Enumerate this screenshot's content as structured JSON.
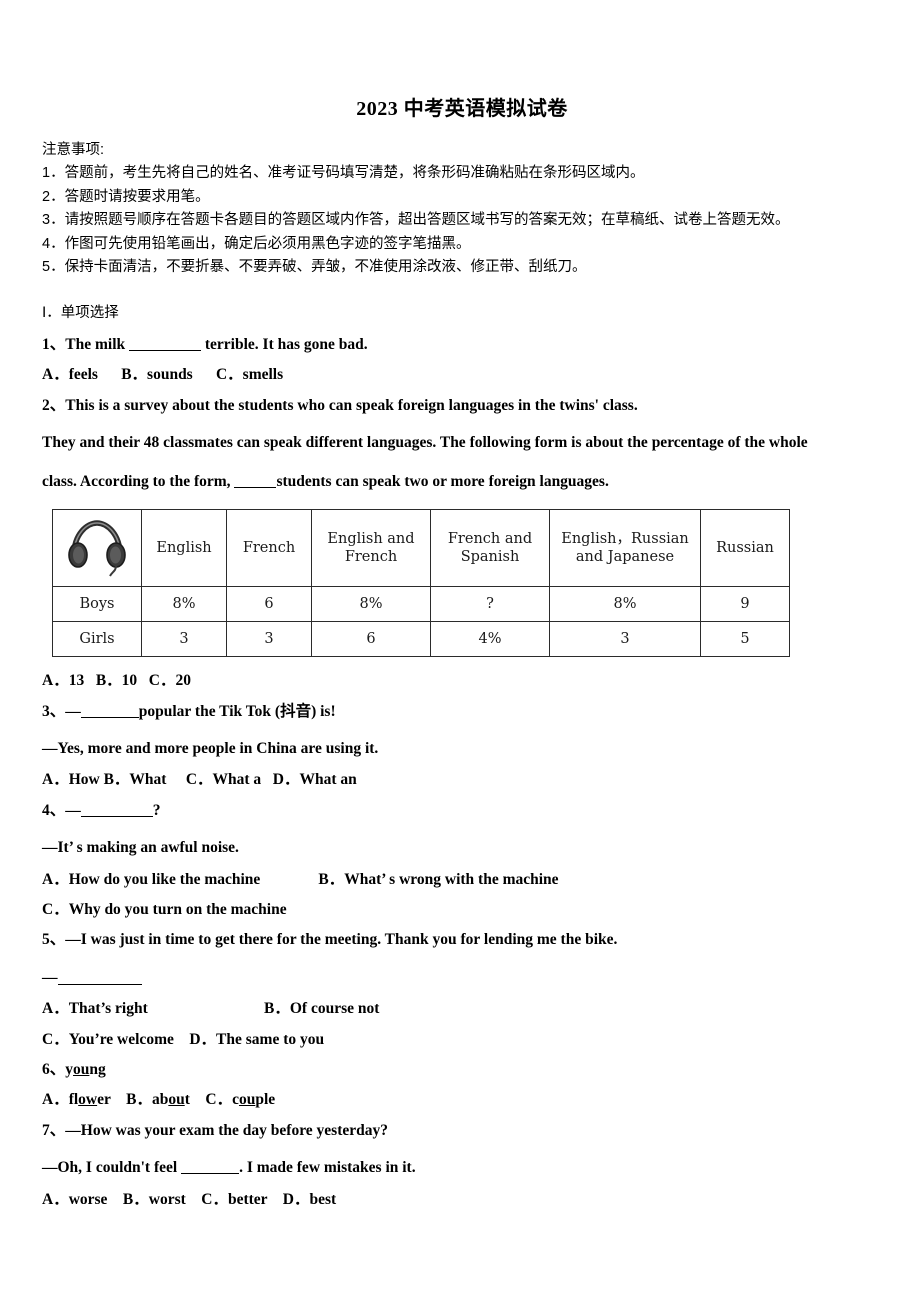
{
  "document": {
    "title": "2023 中考英语模拟试卷",
    "notice_heading": "注意事项:",
    "notice_items": [
      "1．答题前，考生先将自己的姓名、准考证号码填写清楚，将条形码准确粘贴在条形码区域内。",
      "2．答题时请按要求用笔。",
      "3．请按照题号顺序在答题卡各题目的答题区域内作答，超出答题区域书写的答案无效；在草稿纸、试卷上答题无效。",
      "4．作图可先使用铅笔画出，确定后必须用黑色字迹的签字笔描黑。",
      "5．保持卡面清洁，不要折暴、不要弄破、弄皱，不准使用涂改液、修正带、刮纸刀。"
    ],
    "section_heading": "Ⅰ．单项选择"
  },
  "questions": {
    "q1": {
      "number": "1、",
      "stem_a": "The milk ",
      "stem_b": " terrible. It has gone bad.",
      "options": "A．feels      B．sounds      C．smells"
    },
    "q2": {
      "number": "2、",
      "stem_line1": "This is a survey about the students who can speak foreign languages in the twins' class.",
      "stem_line2": "They and their 48 classmates can speak different languages. The following form is about the percentage of the whole",
      "stem_line3_a": "class. According to the form, ",
      "stem_line3_b": "students can speak two or more foreign languages.",
      "options": "A．13   B．10   C．20"
    },
    "q3": {
      "number": "3、",
      "stem_a": "—",
      "stem_b": "popular the Tik Tok (抖音) is!",
      "reply": "—Yes, more and more people in China are using it.",
      "options": "A．How B．What     C．What a   D．What an"
    },
    "q4": {
      "number": "4、",
      "stem_a": "—",
      "stem_b": "?",
      "reply": "—It’ s making an awful noise.",
      "options_row1": "A．How do you like the machine               B．What’ s wrong with the machine",
      "options_row2": "C．Why do you turn on the machine"
    },
    "q5": {
      "number": "5、",
      "stem": "—I was just in time to get there for the meeting. Thank you for lending me the bike.",
      "reply_dash": "—",
      "options_row1": "A．That’s right                              B．Of course not",
      "options_row2": "C．You’re welcome    D．The same to you"
    },
    "q6": {
      "number": "6、",
      "word_pre": "y",
      "word_underlined": "ou",
      "word_post": "ng",
      "options": [
        {
          "label": "A．",
          "pre": "fl",
          "under": "ow",
          "post": "er"
        },
        {
          "label": "B．",
          "pre": "ab",
          "under": "ou",
          "post": "t"
        },
        {
          "label": "C．",
          "pre": "c",
          "under": "ou",
          "post": "ple"
        }
      ]
    },
    "q7": {
      "number": "7、",
      "stem": "—How was your exam the day before yesterday?",
      "reply_a": "—Oh, I couldn't feel ",
      "reply_b": ". I made few mistakes in it.",
      "options": "A．worse    B．worst    C．better    D．best"
    }
  },
  "chart_data": {
    "type": "table",
    "title": "Survey of foreign languages spoken in the twins' class",
    "icon": "headphones-icon",
    "columns": [
      "",
      "English",
      "French",
      "English and French",
      "French and Spanish",
      "English，Russian and Japanese",
      "Russian"
    ],
    "column_lines": [
      [
        ""
      ],
      [
        "English"
      ],
      [
        "French"
      ],
      [
        "English and",
        "French"
      ],
      [
        "French and",
        "Spanish"
      ],
      [
        "English，Russian",
        "and Japanese"
      ],
      [
        "Russian"
      ]
    ],
    "rows": [
      {
        "label": "Boys",
        "values": [
          "8%",
          "6",
          "8%",
          "?",
          "8%",
          "9"
        ]
      },
      {
        "label": "Girls",
        "values": [
          "3",
          "3",
          "6",
          "4%",
          "3",
          "5"
        ]
      }
    ]
  }
}
